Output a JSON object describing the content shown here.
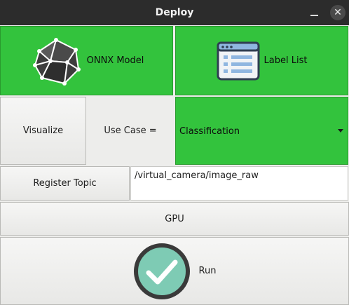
{
  "window": {
    "title": "Deploy",
    "minimize_icon": "minimize-icon",
    "close_icon": "close-icon",
    "close_glyph": "✕"
  },
  "toolbar": {
    "onnx_label": "ONNX Model",
    "onnx_icon": "polyhedron-icon",
    "label_list_label": "Label List",
    "label_list_icon": "list-window-icon"
  },
  "controls": {
    "visualize_label": "Visualize",
    "use_case_label": "Use Case =",
    "use_case_value": "Classification",
    "register_topic_label": "Register Topic",
    "topic_value": "/virtual_camera/image_raw",
    "gpu_label": "GPU",
    "run_label": "Run",
    "run_icon": "checkmark-circle-icon"
  },
  "colors": {
    "green": "#33c33d",
    "titlebar": "#2c2c2c",
    "run_icon_fill": "#7ecbb4",
    "run_icon_ring": "#3a3a3a"
  }
}
